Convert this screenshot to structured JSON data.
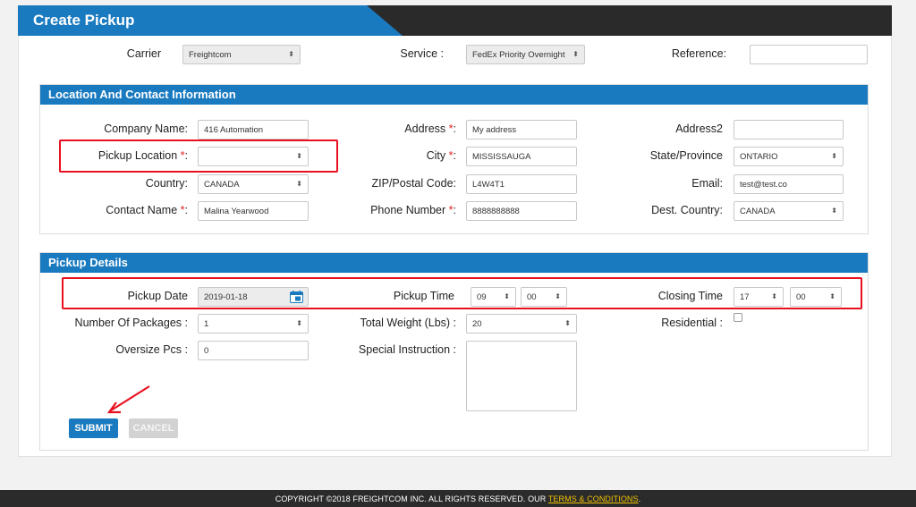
{
  "page": {
    "title": "Create Pickup"
  },
  "header_row": {
    "carrier_label": "Carrier",
    "carrier_value": "Freightcom",
    "service_label": "Service :",
    "service_value": "FedEx Priority Overnight",
    "reference_label": "Reference:",
    "reference_value": ""
  },
  "location": {
    "heading": "Location And Contact Information",
    "company_label": "Company Name:",
    "company_value": "416 Automation",
    "pickup_location_label": "Pickup Location",
    "pickup_location_value": "",
    "country_label": "Country:",
    "country_value": "CANADA",
    "contact_label": "Contact Name",
    "contact_value": "Malina Yearwood",
    "address_label": "Address",
    "address_value": "My address",
    "city_label": "City",
    "city_value": "MISSISSAUGA",
    "zip_label": "ZIP/Postal Code:",
    "zip_value": "L4W4T1",
    "phone_label": "Phone Number",
    "phone_value": "8888888888",
    "address2_label": "Address2",
    "address2_value": "",
    "state_label": "State/Province",
    "state_value": "ONTARIO",
    "email_label": "Email:",
    "email_value": "test@test.co",
    "dest_country_label": "Dest. Country:",
    "dest_country_value": "CANADA",
    "required_mark": "*",
    "required_suffix": ":"
  },
  "pickup": {
    "heading": "Pickup Details",
    "date_label": "Pickup Date",
    "date_value": "2019-01-18",
    "time_label": "Pickup Time",
    "time_hour": "09",
    "time_min": "00",
    "closing_label": "Closing Time",
    "closing_hour": "17",
    "closing_min": "00",
    "packages_label": "Number Of Packages :",
    "packages_value": "1",
    "weight_label": "Total Weight (Lbs) :",
    "weight_value": "20",
    "residential_label": "Residential :",
    "oversize_label": "Oversize Pcs :",
    "oversize_value": "0",
    "instruction_label": "Special Instruction :"
  },
  "buttons": {
    "submit": "SUBMIT",
    "cancel": "CANCEL"
  },
  "footer": {
    "text": "COPYRIGHT ©2018 FREIGHTCOM INC. ALL RIGHTS RESERVED.   OUR ",
    "link": "TERMS & CONDITIONS",
    "end": "."
  },
  "colors": {
    "accent": "#1a7ac0",
    "highlight": "#e8101f",
    "footer_link": "#f2c200"
  },
  "icons": [
    "select-arrows-icon",
    "calendar-icon",
    "arrow-icon"
  ]
}
